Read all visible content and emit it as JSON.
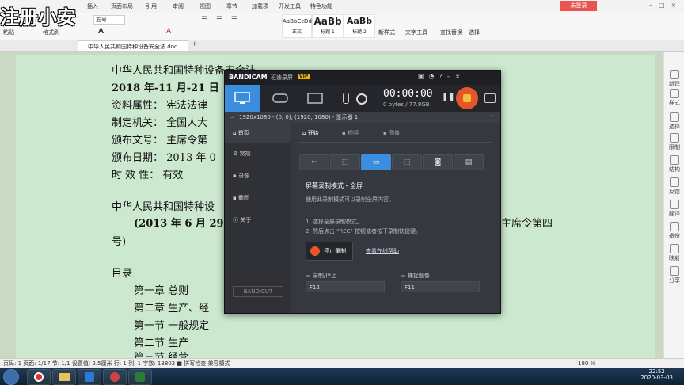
{
  "watermark": "注册小安",
  "menu": [
    "插入",
    "页面布局",
    "引用",
    "审阅",
    "视图",
    "章节",
    "加载项",
    "开发工具",
    "特色功能"
  ],
  "login_button": "未登录",
  "ribbon": {
    "paste": "粘贴",
    "format_painter": "格式刷",
    "font_size": "五号",
    "styles": [
      {
        "preview": "AaBbCcDd",
        "name": "正文"
      },
      {
        "preview": "AaBb",
        "name": "标题 1"
      },
      {
        "preview": "AaBb",
        "name": "标题 2"
      }
    ],
    "new_style": "新样式",
    "text_tools": "文字工具",
    "find_replace": "查找替换",
    "select": "选择"
  },
  "doc_tab": "中华人民共和国特种设备安全法.doc",
  "right_panel": [
    "新建",
    "样式",
    "选择",
    "限制",
    "结构",
    "反馈",
    "翻译",
    "备份",
    "映射",
    "分享"
  ],
  "doc_lines": [
    {
      "t": "中华人民共和国特种设备安全法",
      "bold": false
    },
    {
      "t": "2018 年-11 月-21 日",
      "bold": true
    },
    {
      "t": "资料属性：    宪法法律",
      "bold": false
    },
    {
      "t": "制定机关：    全国人大",
      "bold": false
    },
    {
      "t": "颁布文号：    主席令第",
      "bold": false
    },
    {
      "t": "颁布日期：    2013 年 0",
      "bold": false
    },
    {
      "t": "时  效  性：    有效",
      "bold": false
    },
    {
      "t": "中华人民共和国特种设",
      "bold": false
    },
    {
      "t": "(2013 年 6 月 29 日",
      "bold": true
    },
    {
      "t": "号)",
      "bold": false
    },
    {
      "t": "目录",
      "bold": false
    },
    {
      "t": "第一章    总则",
      "bold": false
    },
    {
      "t": "第二章    生产、经",
      "bold": false
    },
    {
      "t": "第一节    一般规定",
      "bold": false
    },
    {
      "t": "第二节    生产",
      "bold": false
    },
    {
      "t": "第三节    经营",
      "bold": false
    }
  ],
  "doc_right_fragment": "主席令第四",
  "status": "页码: 1   页面: 1/17   节: 1/1   设置值: 2.5厘米   行: 1   列: 1   字数: 13802   ■ 拼写检查   兼容模式",
  "zoom": "180 %",
  "clock_time": "22:52",
  "clock_date": "2020-03-03",
  "bandicam": {
    "brand": "BANDICAM",
    "brand_sub": "班迪录屏",
    "vip": "VIP",
    "timer": "00:00:00",
    "size": "0 bytes / 77.8GB",
    "info": "1920x1080 - (0, 0), (1920, 1080) - 显示器 1",
    "side": [
      "首页",
      "常规",
      "录像",
      "截图",
      "关于"
    ],
    "bandicut": "BANDICUT",
    "subtabs": [
      "开始",
      "视频",
      "图像"
    ],
    "mode_title": "屏幕录制模式 - 全屏",
    "mode_desc": "使用此录制模式可以录制全屏内容。",
    "step1": "1. 选择全屏录制模式。",
    "step2": "2. 然后点击 \"REC\" 按钮或者按下录制快捷键。",
    "stop_button": "停止录制",
    "help_link": "查看在线帮助",
    "hotkey_label1": "录制/停止",
    "hotkey_value1": "F12",
    "hotkey_label2": "捕捉图像",
    "hotkey_value2": "F11"
  }
}
